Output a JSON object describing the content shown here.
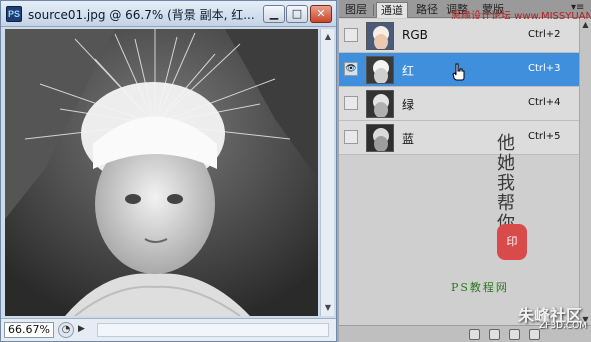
{
  "document": {
    "app_icon": "PS",
    "title": "source01.jpg @ 66.7% (背景 副本, 红...",
    "buttons": {
      "minimize": "▁",
      "maximize": "□",
      "close": "✕"
    },
    "zoom": "66.67%"
  },
  "panel": {
    "tabs": [
      "图层",
      "通道",
      "路径",
      "调整",
      "蒙版"
    ],
    "active_tab": "通道",
    "watermark_top": "思缘设计论坛 www.MISSYUAN.COM",
    "channels": [
      {
        "name": "RGB",
        "shortcut": "Ctrl+2",
        "visible": false,
        "selected": false
      },
      {
        "name": "红",
        "shortcut": "Ctrl+3",
        "visible": true,
        "selected": true
      },
      {
        "name": "绿",
        "shortcut": "Ctrl+4",
        "visible": false,
        "selected": false
      },
      {
        "name": "蓝",
        "shortcut": "Ctrl+5",
        "visible": false,
        "selected": false
      }
    ],
    "calligraphy": "他 她 我 帮 你",
    "seal": "印",
    "signature": "PS教程网",
    "site_watermark": "朱峰社区",
    "site_url": "ZF3D.COM"
  },
  "colors": {
    "selection": "#3f8fdc",
    "panel_bg": "#cfcfcf",
    "titlebar": "#c4d3e4"
  },
  "icons": [
    "photoshop-logo",
    "eye-icon",
    "hand-pointer-cursor",
    "panel-menu-icon"
  ]
}
